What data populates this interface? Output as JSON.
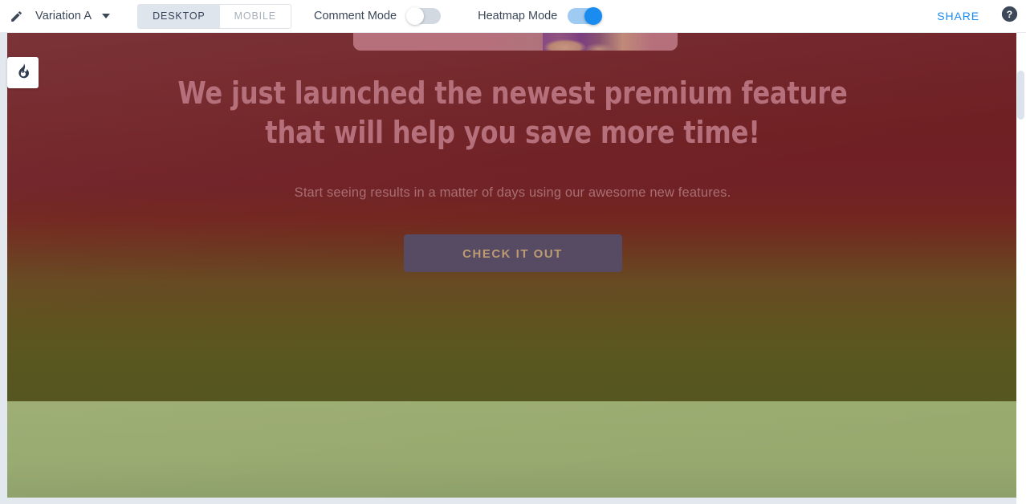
{
  "toolbar": {
    "edit_icon": "pencil-icon",
    "variation_label": "Variation A",
    "dropdown_icon": "chevron-down-icon",
    "device_tabs": [
      {
        "label": "DESKTOP",
        "selected": true
      },
      {
        "label": "MOBILE",
        "selected": false
      }
    ],
    "comment_mode": {
      "label": "Comment Mode",
      "enabled": false
    },
    "heatmap_mode": {
      "label": "Heatmap Mode",
      "enabled": true
    },
    "share_label": "SHARE",
    "help_icon": "help-circle-icon"
  },
  "canvas": {
    "flame_icon": "flame-icon",
    "hero": {
      "headline_line1": "We just launched the newest premium feature",
      "headline_line2": "that will help you save more time!",
      "subheadline": "Start seeing results in a matter of days using our awesome new features.",
      "cta_label": "CHECK IT OUT"
    }
  },
  "colors": {
    "accent_blue": "#1a8cf0",
    "toolbar_text": "#3c4858",
    "heat_hot": "#6e1f24",
    "heat_mid": "#674a22",
    "heat_cool": "#9aab6f",
    "cta_bg": "#574a63",
    "cta_text": "#bb9b72",
    "headline_text": "#b5707c"
  }
}
